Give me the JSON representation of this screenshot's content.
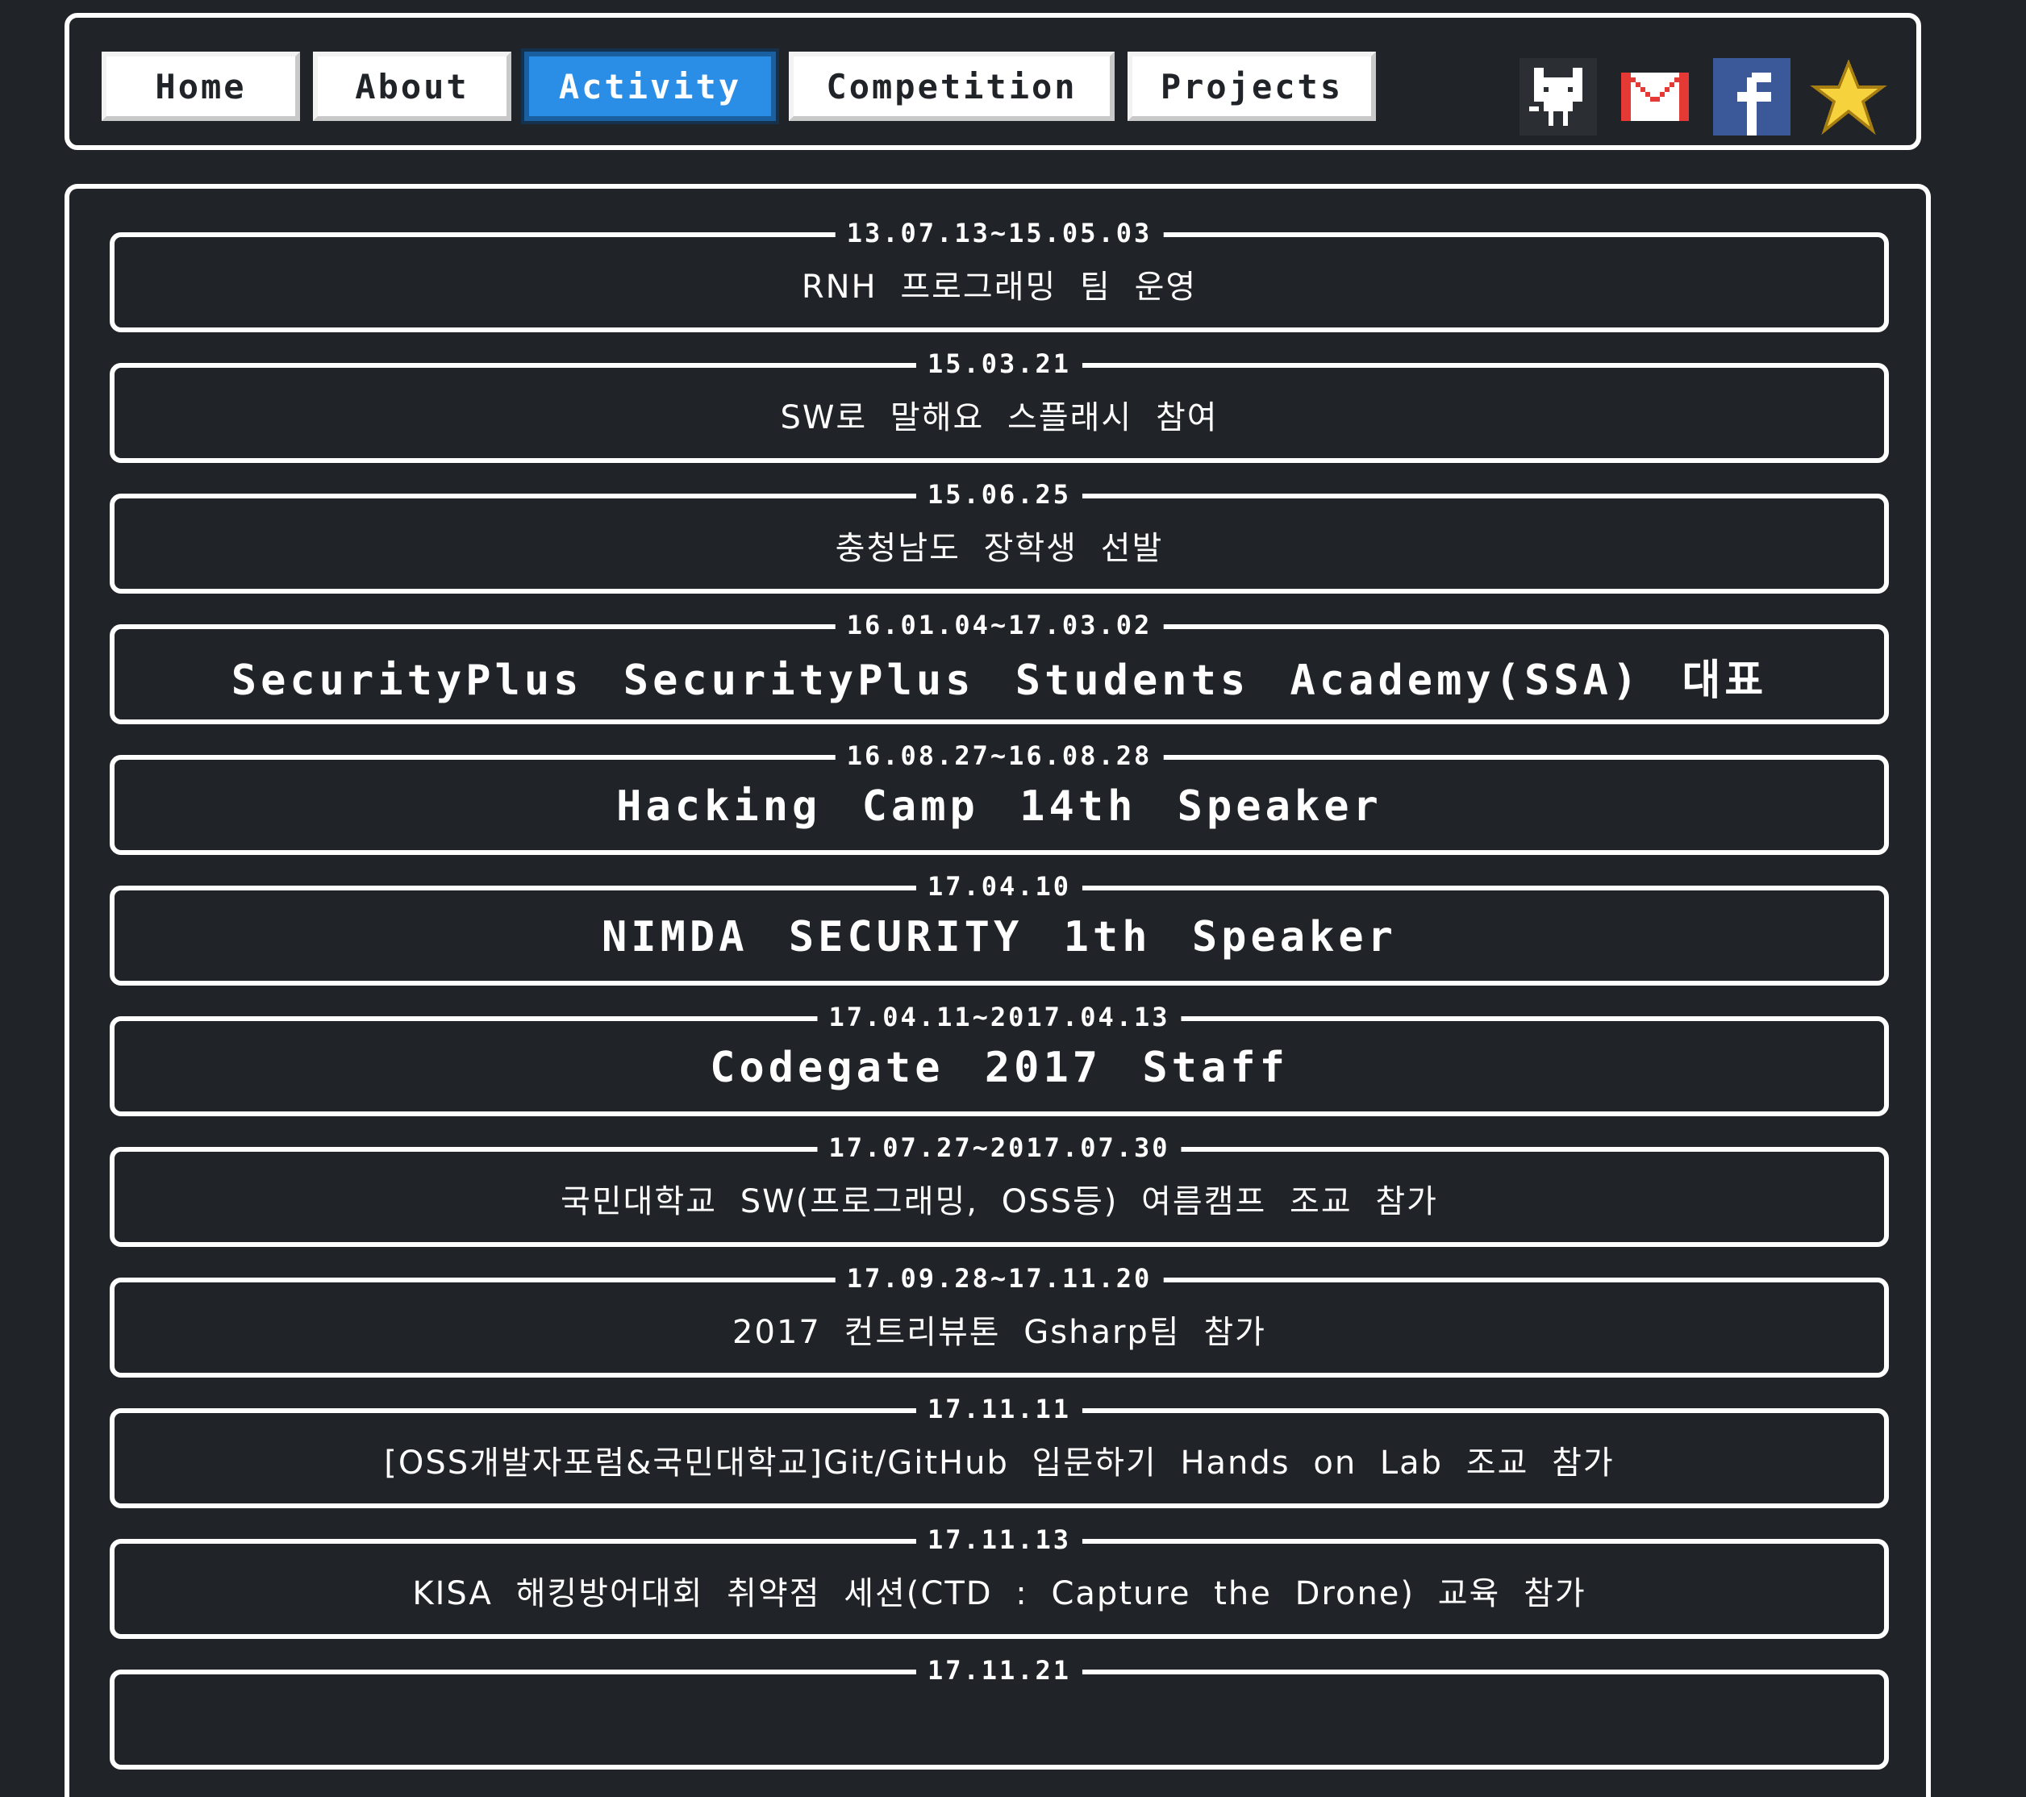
{
  "nav": {
    "items": [
      {
        "label": "Home",
        "active": false
      },
      {
        "label": "About",
        "active": false
      },
      {
        "label": "Activity",
        "active": true
      },
      {
        "label": "Competition",
        "active": false
      },
      {
        "label": "Projects",
        "active": false
      }
    ],
    "icons": [
      "github-icon",
      "gmail-icon",
      "facebook-icon",
      "star-icon"
    ]
  },
  "colors": {
    "background": "#202327",
    "active_tab": "#2a8ee6",
    "frame": "#ffffff"
  },
  "activities": [
    {
      "date": "13.07.13~15.05.03",
      "title": "RNH 프로그래밍 팀 운영"
    },
    {
      "date": "15.03.21",
      "title": "SW로 말해요 스플래시 참여"
    },
    {
      "date": "15.06.25",
      "title": "충청남도 장학생 선발"
    },
    {
      "date": "16.01.04~17.03.02",
      "title": "SecurityPlus SecurityPlus Students Academy(SSA) 대표"
    },
    {
      "date": "16.08.27~16.08.28",
      "title": "Hacking Camp 14th Speaker"
    },
    {
      "date": "17.04.10",
      "title": "NIMDA SECURITY 1th Speaker"
    },
    {
      "date": "17.04.11~2017.04.13",
      "title": "Codegate 2017 Staff"
    },
    {
      "date": "17.07.27~2017.07.30",
      "title": "국민대학교 SW(프로그래밍, OSS등) 여름캠프 조교 참가"
    },
    {
      "date": "17.09.28~17.11.20",
      "title": "2017 컨트리뷰톤 Gsharp팀 참가"
    },
    {
      "date": "17.11.11",
      "title": "[OSS개발자포럼&국민대학교]Git/GitHub 입문하기 Hands on Lab 조교 참가"
    },
    {
      "date": "17.11.13",
      "title": "KISA 해킹방어대회 취약점 세션(CTD : Capture the Drone) 교육 참가"
    },
    {
      "date": "17.11.21",
      "title": ""
    }
  ]
}
